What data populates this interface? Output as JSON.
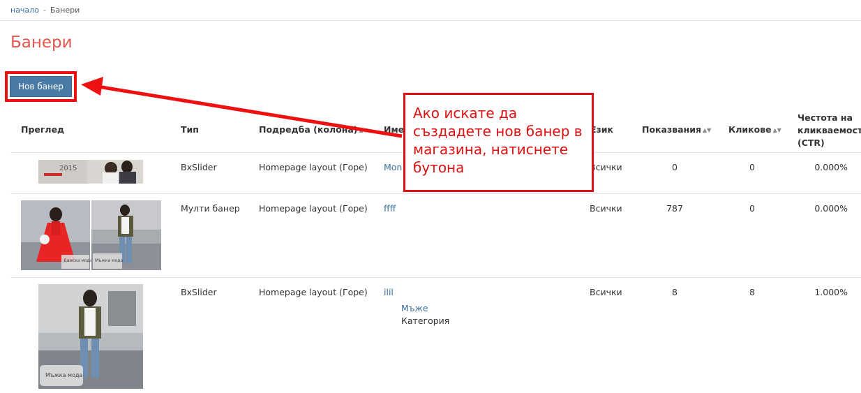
{
  "breadcrumb": {
    "home": "начало",
    "separator": "-",
    "current": "Банери"
  },
  "page": {
    "title": "Банери"
  },
  "toolbar": {
    "new_banner_label": "Нов банер"
  },
  "table": {
    "columns": {
      "preview": "Преглед",
      "type": "Тип",
      "order": "Подредба (колона)",
      "name": "Име",
      "language": "Език",
      "impressions": "Показвания",
      "clicks": "Кликове",
      "ctr": "Честота на кликваемост (CTR)"
    },
    "rows": [
      {
        "type": "BxSlider",
        "layout": "Homepage layout (Горе)",
        "name": "Mon",
        "language": "Всички",
        "impressions": "0",
        "clicks": "0",
        "ctr": "0.000%",
        "thumb_text": "2015"
      },
      {
        "type": "Мулти банер",
        "layout": "Homepage layout (Горе)",
        "name": "ffff",
        "language": "Всички",
        "impressions": "787",
        "clicks": "0",
        "ctr": "0.000%",
        "thumb_left_text": "Дамска мода",
        "thumb_right_text": "Мъжка мода"
      },
      {
        "type": "BxSlider",
        "layout": "Homepage layout (Горе)",
        "name": "ilil",
        "category_link": "Мъже",
        "category_label": "Категория",
        "language": "Всички",
        "impressions": "8",
        "clicks": "8",
        "ctr": "1.000%",
        "thumb_text": "Мъжка мода"
      }
    ]
  },
  "callout": {
    "text": "Ако искате да създадете нов банер в магазина, натиснете бутона"
  },
  "colors": {
    "accent_title": "#e4574f",
    "button": "#4a7aa6",
    "annotation": "#dd1111",
    "link": "#3a6d99"
  }
}
